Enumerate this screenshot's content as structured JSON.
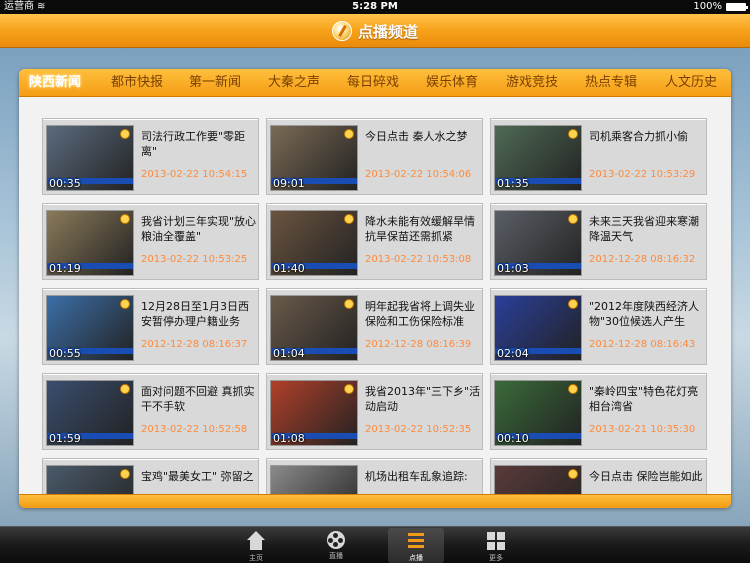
{
  "statusbar": {
    "carrier": "运营商",
    "time": "5:28 PM",
    "battery": "100%"
  },
  "app": {
    "title": "点播频道"
  },
  "tabs": [
    {
      "label": "陕西新闻",
      "active": true
    },
    {
      "label": "都市快报"
    },
    {
      "label": "第一新闻"
    },
    {
      "label": "大秦之声"
    },
    {
      "label": "每日碎戏"
    },
    {
      "label": "娱乐体育"
    },
    {
      "label": "游戏竞技"
    },
    {
      "label": "热点专辑"
    },
    {
      "label": "人文历史"
    }
  ],
  "videos": [
    {
      "title": "司法行政工作要\"零距离\"",
      "date": "2013-02-22 10:54:15",
      "duration": "00:35",
      "thumb_color": "#5b6b7e"
    },
    {
      "title": "今日点击 秦人水之梦",
      "date": "2013-02-22 10:54:06",
      "duration": "09:01",
      "thumb_color": "#7a6a55"
    },
    {
      "title": "司机乘客合力抓小偷",
      "date": "2013-02-22 10:53:29",
      "duration": "01:35",
      "thumb_color": "#4f6a55"
    },
    {
      "title": "我省计划三年实现\"放心粮油全覆盖\"",
      "date": "2013-02-22 10:53:25",
      "duration": "01:19",
      "thumb_color": "#8a7a5a"
    },
    {
      "title": "降水未能有效缓解旱情 抗旱保苗还需抓紧",
      "date": "2013-02-22 10:53:08",
      "duration": "01:40",
      "thumb_color": "#6b5440"
    },
    {
      "title": "未来三天我省迎来寒潮降温天气",
      "date": "2012-12-28 08:16:32",
      "duration": "01:03",
      "thumb_color": "#5a5f66"
    },
    {
      "title": "12月28日至1月3日西安暂停办理户籍业务",
      "date": "2012-12-28 08:16:37",
      "duration": "00:55",
      "thumb_color": "#3c6fa8"
    },
    {
      "title": "明年起我省将上调失业保险和工伤保险标准",
      "date": "2012-12-28 08:16:39",
      "duration": "01:04",
      "thumb_color": "#6a5a4a"
    },
    {
      "title": "\"2012年度陕西经济人物\"30位候选人产生",
      "date": "2012-12-28 08:16:43",
      "duration": "02:04",
      "thumb_color": "#2a3f9a"
    },
    {
      "title": "面对问题不回避 真抓实干不手软",
      "date": "2013-02-22 10:52:58",
      "duration": "01:59",
      "thumb_color": "#3a4e6e"
    },
    {
      "title": "我省2013年\"三下乡\"活动启动",
      "date": "2013-02-22 10:52:35",
      "duration": "01:08",
      "thumb_color": "#b0402a"
    },
    {
      "title": "\"秦岭四宝\"特色花灯亮相台湾省",
      "date": "2013-02-21 10:35:30",
      "duration": "00:10",
      "thumb_color": "#3a6a3a"
    },
    {
      "title": "宝鸡\"最美女工\" 弥留之",
      "date": "",
      "duration": "",
      "thumb_color": "#4a5a6a"
    },
    {
      "title": "机场出租车乱象追踪:",
      "date": "",
      "duration": "",
      "thumb_color": "#8a8a8a"
    },
    {
      "title": "今日点击 保险岂能如此",
      "date": "",
      "duration": "",
      "thumb_color": "#5a3a3a"
    }
  ],
  "tabbar": [
    {
      "label": "主页",
      "icon": "home-icon"
    },
    {
      "label": "直播",
      "icon": "film-reel-icon"
    },
    {
      "label": "点播",
      "icon": "list-icon",
      "active": true
    },
    {
      "label": "更多",
      "icon": "grid-icon"
    }
  ],
  "colors": {
    "accent": "#f59d14",
    "date": "#ff8a3a"
  }
}
